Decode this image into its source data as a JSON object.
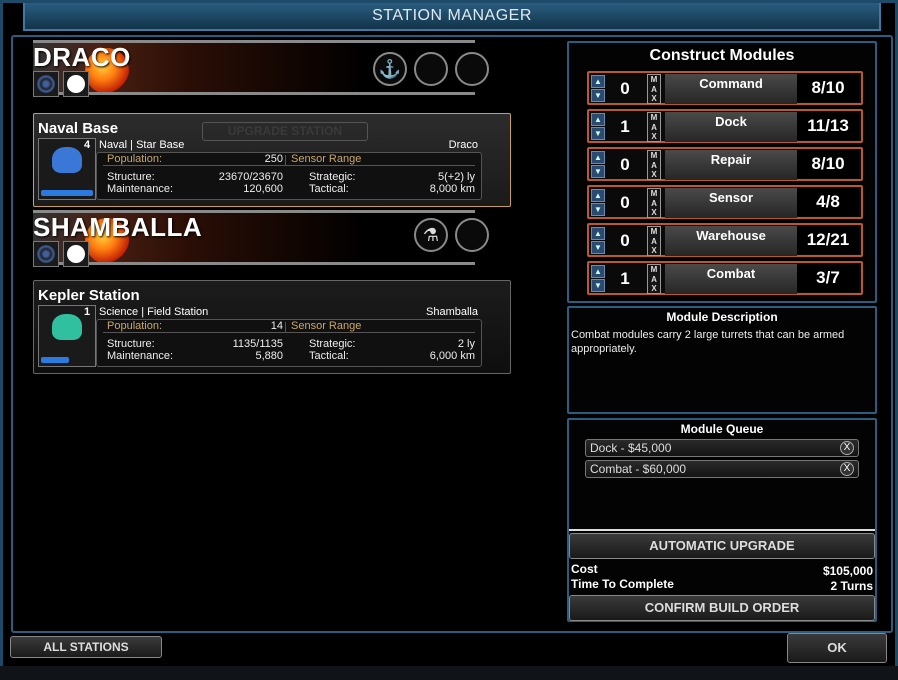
{
  "window": {
    "title": "STATION MANAGER"
  },
  "systems": [
    {
      "name": "DRACO",
      "slot_icons": [
        "anchor-icon",
        "",
        ""
      ],
      "station": {
        "name": "Naval Base",
        "level": "4",
        "type": "Naval | Star Base",
        "location": "Draco",
        "upgrade_label": "UPGRADE STATION",
        "population_label": "Population:",
        "population": "250",
        "sensor_label": "Sensor Range",
        "structure_label": "Structure:",
        "structure": "23670/23670",
        "maintenance_label": "Maintenance:",
        "maintenance": "120,600",
        "strategic_label": "Strategic:",
        "strategic": "5(+2) ly",
        "tactical_label": "Tactical:",
        "tactical": "8,000 km",
        "icon": "naval-ship-icon",
        "color": "#3a78d8"
      }
    },
    {
      "name": "SHAMBALLA",
      "slot_icons": [
        "flask-icon",
        ""
      ],
      "station": {
        "name": "Kepler Station",
        "level": "1",
        "type": "Science | Field Station",
        "location": "Shamballa",
        "population_label": "Population:",
        "population": "14",
        "sensor_label": "Sensor Range",
        "structure_label": "Structure:",
        "structure": "1135/1135",
        "maintenance_label": "Maintenance:",
        "maintenance": "5,880",
        "strategic_label": "Strategic:",
        "strategic": "2 ly",
        "tactical_label": "Tactical:",
        "tactical": "6,000 km",
        "icon": "science-ship-icon",
        "color": "#30c0a0"
      }
    }
  ],
  "construct": {
    "title": "Construct Modules",
    "max_label": "MAX",
    "modules": [
      {
        "name": "Command",
        "count": "0",
        "value": "8/10"
      },
      {
        "name": "Dock",
        "count": "1",
        "value": "11/13"
      },
      {
        "name": "Repair",
        "count": "0",
        "value": "8/10"
      },
      {
        "name": "Sensor",
        "count": "0",
        "value": "4/8"
      },
      {
        "name": "Warehouse",
        "count": "0",
        "value": "12/21"
      },
      {
        "name": "Combat",
        "count": "1",
        "value": "3/7"
      }
    ]
  },
  "description": {
    "title": "Module Description",
    "text": "Combat modules carry 2 large turrets that can be armed appropriately."
  },
  "queue": {
    "title": "Module Queue",
    "items": [
      "Dock - $45,000",
      "Combat - $60,000"
    ],
    "auto_label": "AUTOMATIC UPGRADE",
    "cost_label": "Cost",
    "cost": "$105,000",
    "time_label": "Time To Complete",
    "time": "2 Turns",
    "confirm_label": "CONFIRM BUILD ORDER"
  },
  "bottom": {
    "all_stations": "ALL STATIONS",
    "ok": "OK"
  },
  "colors": {
    "accent": "#2a5d80",
    "module_border": "#b85a2a",
    "label": "#c9a66a"
  }
}
